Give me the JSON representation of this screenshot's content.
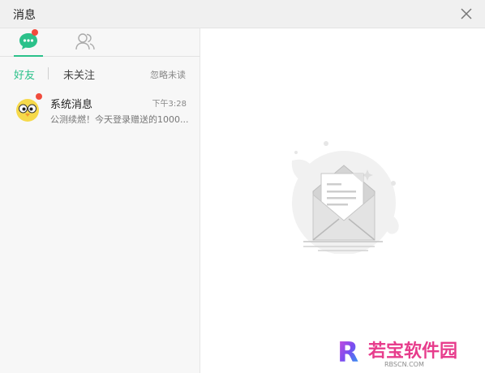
{
  "window": {
    "title": "消息"
  },
  "tabs": {
    "chat_icon": "chat-bubble-icon",
    "contacts_icon": "contacts-icon",
    "friends_label": "好友",
    "not_followed_label": "未关注",
    "ignore_unread_label": "忽略未读"
  },
  "messages": [
    {
      "name": "系统消息",
      "time": "下午3:28",
      "preview": "公测续燃！今天登录赠送的1000...",
      "unread": true,
      "avatar": "chick-avatar-icon"
    }
  ],
  "empty_state": {
    "icon": "envelope-letter-icon"
  },
  "watermark": {
    "logo_letter": "R",
    "brand": "若宝软件园",
    "domain": "RBSCN.COM"
  },
  "colors": {
    "accent": "#2bc18a",
    "badge": "#f04b3c",
    "titlebar": "#f0f0f0",
    "sidebar": "#f7f7f7"
  }
}
